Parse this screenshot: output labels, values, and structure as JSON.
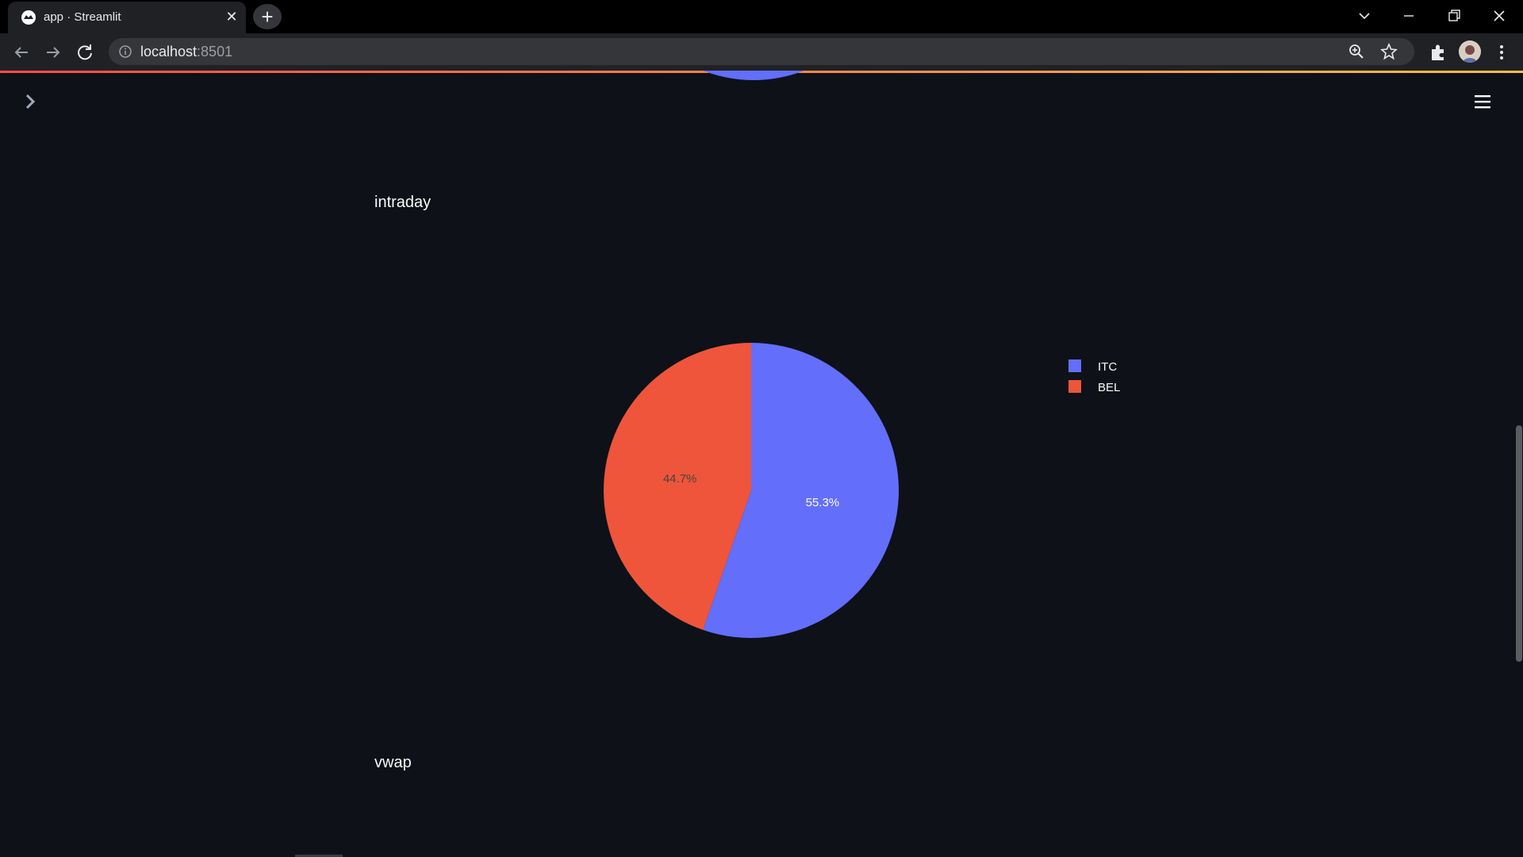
{
  "browser": {
    "tab_title": "app · Streamlit",
    "url_host": "localhost",
    "url_port": ":8501"
  },
  "app": {
    "sections": [
      {
        "title": "intraday"
      },
      {
        "title": "vwap"
      }
    ]
  },
  "colors": {
    "background": "#0e1117",
    "itc": "#636efa",
    "bel": "#ef553b",
    "accent_start": "#ff4b4b",
    "accent_end": "#ffbd45"
  },
  "chart_data": {
    "type": "pie",
    "labels": [
      "ITC",
      "BEL"
    ],
    "values": [
      55.3,
      44.7
    ],
    "text_labels": [
      "55.3%",
      "44.7%"
    ],
    "colors": [
      "#636efa",
      "#ef553b"
    ],
    "legend_position": "top-right"
  }
}
